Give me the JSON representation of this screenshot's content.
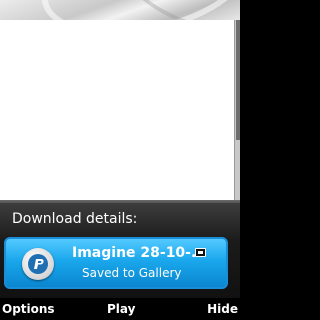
{
  "popup": {
    "title": "Download details:",
    "item": {
      "title": "Imagine 28-10-...",
      "subtitle": "Saved to Gallery",
      "app_icon": "realplayer-icon",
      "storage_icon": "memory-card-icon"
    }
  },
  "softkeys": {
    "left": "Options",
    "middle": "Play",
    "right": "Hide"
  },
  "colors": {
    "highlight": "#1aa7ec",
    "background": "#ffffff"
  }
}
